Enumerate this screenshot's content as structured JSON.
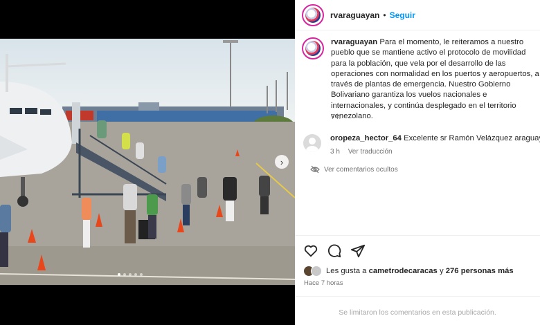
{
  "post": {
    "username": "rvaraguayan",
    "separator": "•",
    "follow_label": "Seguir",
    "caption": "Para el momento, le reiteramos a nuestro pueblo que se mantiene activo el protocolo de movilidad para la población, que vela por el desarrollo de las operaciones con normalidad en los puertos y aeropuertos, a través de plantas de emergencia. Nuestro Gobierno Bolivariano garantiza los vuelos nacionales e internacionales, y continúa desplegado en el territorio venezolano.",
    "caption_time": "7 h",
    "media": {
      "current_index": 1,
      "total": 5,
      "next_icon": "chevron-right-icon"
    }
  },
  "comments": [
    {
      "username": "oropeza_hector_64",
      "text": "Excelente sr Ramón Velázquez araguayan",
      "time": "3 h",
      "action": "Ver traducción"
    }
  ],
  "hidden_comments_label": "Ver comentarios ocultos",
  "likes": {
    "prefix": "Les gusta a",
    "user": "cametrodecaracas",
    "connector": "y",
    "others": "276 personas más"
  },
  "post_time": "Hace 7 horas",
  "comments_closed": "Se limitaron los comentarios en esta publicación.",
  "icons": [
    "heart-icon",
    "comment-icon",
    "share-icon",
    "eye-off-icon"
  ],
  "colors": {
    "accent": "#0095f6",
    "text": "#262626",
    "muted": "#737373"
  }
}
